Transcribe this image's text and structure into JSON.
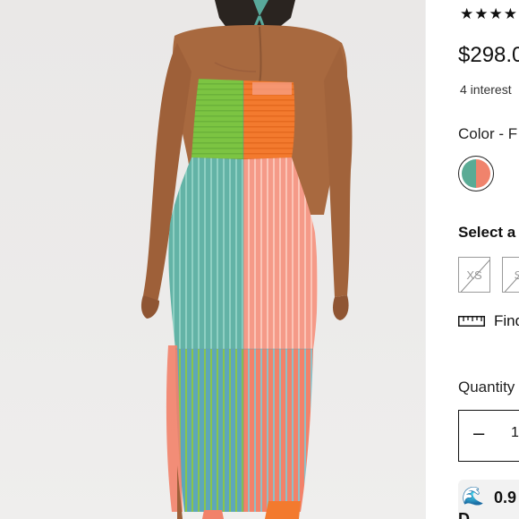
{
  "product_image": {
    "alt": "",
    "colors": {
      "skin": "#a66a43",
      "skin_shadow": "#8c5634",
      "green": "#7cc442",
      "orange": "#f37a2e",
      "teal": "#64b4a8",
      "pink": "#f49a86",
      "coral": "#f4836b",
      "blue_panel": "#5ba7b4",
      "rib_line": "#ffffff"
    }
  },
  "rating": {
    "stars_text": "★★★★★"
  },
  "price": "$298.0",
  "interest_text": "4 interest",
  "color": {
    "label": "Color - F",
    "swatch": {
      "left_color": "#5aab95",
      "right_color": "#f0836c"
    }
  },
  "size": {
    "label": "Select a",
    "options": [
      {
        "label": "XS",
        "available": false
      },
      {
        "label": "S",
        "available": false
      }
    ]
  },
  "fit_finder": {
    "icon": "ruler-icon",
    "label": "Find"
  },
  "quantity": {
    "label": "Quantity",
    "minus": "–",
    "value": "1"
  },
  "badge": {
    "icon": "wave-icon",
    "emoji": "🌊",
    "value": "0.9",
    "sub": "D"
  }
}
